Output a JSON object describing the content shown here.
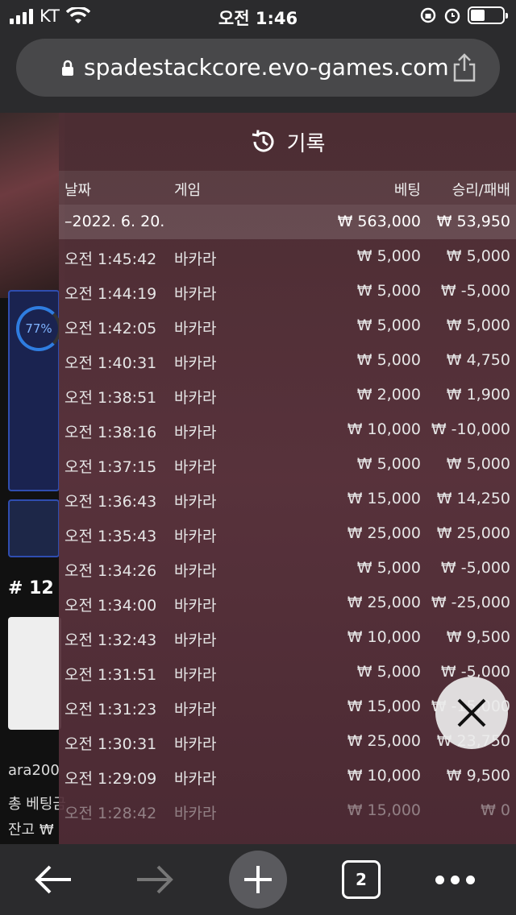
{
  "status_bar": {
    "carrier": "KT",
    "time": "오전 1:46"
  },
  "browser": {
    "url": "spadestackcore.evo-games.com",
    "tab_count": "2"
  },
  "background_page": {
    "progress_label": "77%",
    "table_number": "# 12",
    "username": "ara200",
    "total_bet_label": "총 베팅금",
    "balance_label": "잔고 ₩"
  },
  "history": {
    "title": "기록",
    "columns": {
      "date": "날짜",
      "game": "게임",
      "bet": "베팅",
      "result": "승리/패배"
    },
    "summary": {
      "date": "–2022. 6. 20.",
      "bet": "₩ 563,000",
      "result": "₩ 53,950"
    },
    "rows": [
      {
        "time": "오전 1:45:42",
        "game": "바카라",
        "bet": "₩ 5,000",
        "result": "₩ 5,000"
      },
      {
        "time": "오전 1:44:19",
        "game": "바카라",
        "bet": "₩ 5,000",
        "result": "₩ -5,000"
      },
      {
        "time": "오전 1:42:05",
        "game": "바카라",
        "bet": "₩ 5,000",
        "result": "₩ 5,000"
      },
      {
        "time": "오전 1:40:31",
        "game": "바카라",
        "bet": "₩ 5,000",
        "result": "₩ 4,750"
      },
      {
        "time": "오전 1:38:51",
        "game": "바카라",
        "bet": "₩ 2,000",
        "result": "₩ 1,900"
      },
      {
        "time": "오전 1:38:16",
        "game": "바카라",
        "bet": "₩ 10,000",
        "result": "₩ -10,000"
      },
      {
        "time": "오전 1:37:15",
        "game": "바카라",
        "bet": "₩ 5,000",
        "result": "₩ 5,000"
      },
      {
        "time": "오전 1:36:43",
        "game": "바카라",
        "bet": "₩ 15,000",
        "result": "₩ 14,250"
      },
      {
        "time": "오전 1:35:43",
        "game": "바카라",
        "bet": "₩ 25,000",
        "result": "₩ 25,000"
      },
      {
        "time": "오전 1:34:26",
        "game": "바카라",
        "bet": "₩ 5,000",
        "result": "₩ -5,000"
      },
      {
        "time": "오전 1:34:00",
        "game": "바카라",
        "bet": "₩ 25,000",
        "result": "₩ -25,000"
      },
      {
        "time": "오전 1:32:43",
        "game": "바카라",
        "bet": "₩ 10,000",
        "result": "₩ 9,500"
      },
      {
        "time": "오전 1:31:51",
        "game": "바카라",
        "bet": "₩ 5,000",
        "result": "₩ -5,000"
      },
      {
        "time": "오전 1:31:23",
        "game": "바카라",
        "bet": "₩ 15,000",
        "result": "₩ -15,000"
      },
      {
        "time": "오전 1:30:31",
        "game": "바카라",
        "bet": "₩ 25,000",
        "result": "₩ 23,750"
      },
      {
        "time": "오전 1:29:09",
        "game": "바카라",
        "bet": "₩ 10,000",
        "result": "₩ 9,500"
      },
      {
        "time": "오전 1:28:42",
        "game": "바카라",
        "bet": "₩ 15,000",
        "result": "₩ 0"
      }
    ]
  }
}
